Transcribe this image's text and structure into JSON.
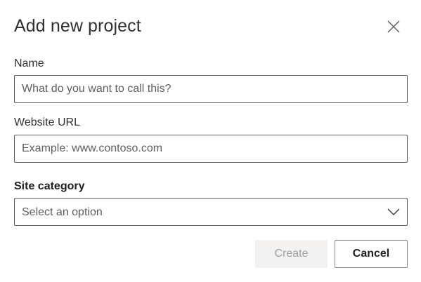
{
  "dialog": {
    "title": "Add new project",
    "close_icon": "close-icon"
  },
  "fields": {
    "name": {
      "label": "Name",
      "value": "",
      "placeholder": "What do you want to call this?"
    },
    "website_url": {
      "label": "Website URL",
      "value": "",
      "placeholder": "Example: www.contoso.com"
    },
    "site_category": {
      "label": "Site category",
      "selected": "Select an option",
      "chevron_icon": "chevron-down-icon"
    }
  },
  "actions": {
    "create_label": "Create",
    "create_disabled": true,
    "cancel_label": "Cancel"
  },
  "colors": {
    "border": "#605e5c",
    "disabled_bg": "#f3f2f1",
    "disabled_text": "#a19f9d",
    "text": "#323130"
  }
}
